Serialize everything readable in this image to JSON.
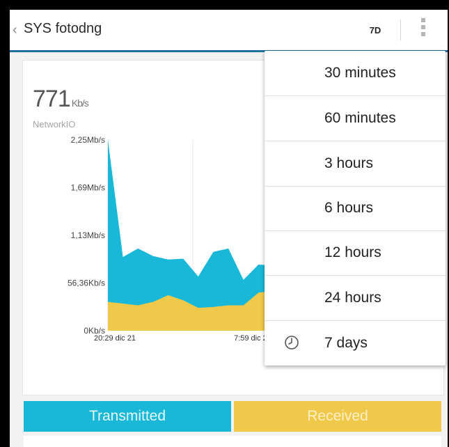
{
  "appbar": {
    "title": "SYS fotodng",
    "range_label": "7D"
  },
  "card": {
    "metric_value": "771",
    "metric_unit": "Kb/s",
    "metric_name": "NetworkIO"
  },
  "chart_data": {
    "type": "area",
    "y_ticks": [
      "2,25Mb/s",
      "1,69Mb/s",
      "1,13Mb/s",
      "56,36Kb/s",
      "0Kb/s"
    ],
    "x_ticks": [
      "20:29 dic 21",
      "7:59 dic 22"
    ],
    "series": [
      {
        "name": "Transmitted",
        "color": "#19b8d8",
        "values": [
          2.25,
          0.87,
          0.97,
          0.88,
          0.84,
          0.85,
          0.64,
          0.93,
          0.97,
          0.6,
          0.78,
          0.77
        ]
      },
      {
        "name": "Received",
        "color": "#f0c94a",
        "values": [
          0.34,
          0.32,
          0.3,
          0.34,
          0.42,
          0.36,
          0.27,
          0.28,
          0.3,
          0.3,
          0.45,
          0.47
        ]
      }
    ],
    "ylim": [
      0,
      2.25
    ],
    "grid": true
  },
  "buttons": {
    "transmitted": "Transmitted",
    "received": "Received"
  },
  "menu": {
    "items": [
      {
        "label": "30 minutes"
      },
      {
        "label": "60 minutes"
      },
      {
        "label": "3 hours"
      },
      {
        "label": "6 hours"
      },
      {
        "label": "12 hours"
      },
      {
        "label": "24 hours"
      },
      {
        "label": "7 days",
        "icon": "clock-icon"
      }
    ]
  }
}
